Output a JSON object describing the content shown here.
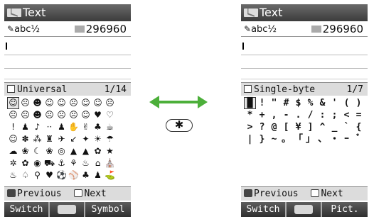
{
  "left_screen": {
    "title": "Text",
    "input_mode": "abc½",
    "remaining_count": "296960",
    "palette_name": "Universal",
    "page_indicator": "1/14",
    "grid_rows": [
      [
        "☺",
        "☹",
        "☻",
        "☺",
        "☺",
        "☹",
        "☺",
        "☺",
        "☹"
      ],
      [
        "☹",
        "☹",
        "☻",
        "☹",
        "☹",
        "☹",
        "☺",
        "♥",
        "♡"
      ],
      [
        "!",
        "♟",
        "♪",
        "··",
        "♟",
        "✋",
        "✌",
        "♣",
        "☕"
      ],
      [
        "☺",
        "✽",
        "⁂",
        "♜",
        "✈",
        "↙",
        "✦",
        "☀",
        "☂"
      ],
      [
        "☁",
        "❀",
        "☾",
        "❀",
        "◎",
        "▲",
        "▲",
        "✿",
        "★"
      ],
      [
        "✲",
        "✿",
        "◉",
        "⛟",
        "⚓",
        "⚘",
        "♨",
        "⌂",
        "⛪"
      ],
      [
        "♨",
        "♤",
        "⚲",
        "♥",
        "⚽",
        "⚾",
        "♣",
        "♟",
        "⛳"
      ]
    ],
    "nav_previous": "Previous",
    "nav_next": "Next",
    "softkey_left": "Switch",
    "softkey_right": "Symbol"
  },
  "right_screen": {
    "title": "Text",
    "input_mode": "abc½",
    "remaining_count": "296960",
    "palette_name": "Single-byte",
    "page_indicator": "1/7",
    "grid_rows": [
      [
        "█",
        "!",
        "\"",
        "#",
        "$",
        "%",
        "&",
        "'",
        "(",
        ")"
      ],
      [
        "*",
        "+",
        ",",
        "-",
        ".",
        "/",
        ":",
        ";",
        "<",
        "="
      ],
      [
        ">",
        "?",
        "@",
        "[",
        "¥",
        "]",
        "^",
        "_",
        "`",
        "{"
      ],
      [
        "|",
        "}",
        "~",
        "。",
        "「",
        "」",
        "、",
        "・",
        "ｰ",
        "ﾞ"
      ]
    ],
    "nav_previous": "Previous",
    "nav_next": "Next",
    "softkey_left": "Switch",
    "softkey_right": "Pict."
  },
  "toggle_key": "✱",
  "colors": {
    "arrow": "#4caf3a",
    "bar_dark": "#3c3c3c",
    "bar_light": "#dcdcdc"
  }
}
